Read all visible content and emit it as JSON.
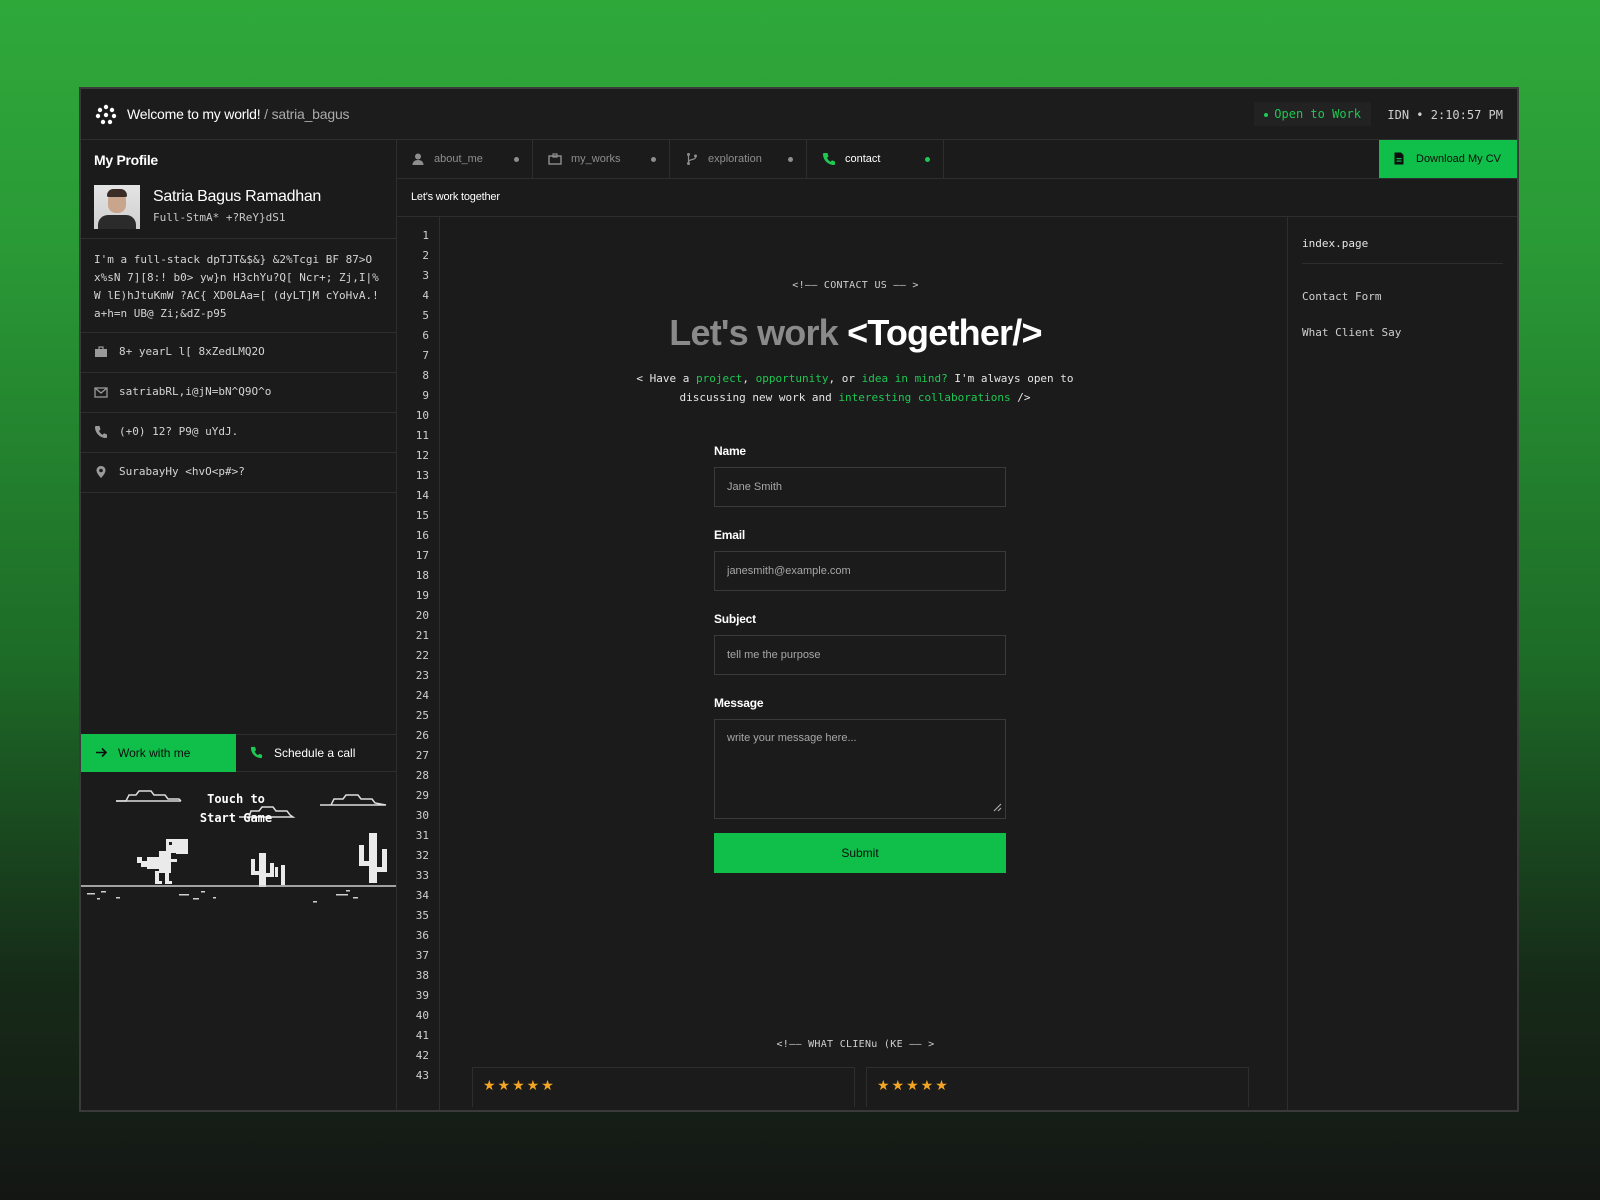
{
  "header": {
    "welcome": "Welcome to my world!",
    "separator": "/",
    "username": "satria_bagus",
    "status": "Open to Work",
    "clock": "IDN • 2:10:57 PM"
  },
  "sidebar": {
    "title": "My Profile",
    "name": "Satria Bagus Ramadhan",
    "role": "Full-StmA* +?ReY}dS1",
    "bio": "I'm a full-stack dpTJT&$&} &2%Tcgi BF 87>Ox%sN 7][8:! b0> yw}n H3chYu?Q[ Ncr+; Zj,I|%W lE)hJtuKmW ?AC{ XD0LAa=[ (dyLT]M cYoHvA.! a+h=n UB@ Zi;&dZ-p95",
    "info": [
      {
        "icon": "briefcase-icon",
        "text": "8+ yearL l[ 8xZedLMQ2O"
      },
      {
        "icon": "mail-icon",
        "text": "satriabRL,i@jN=bN^Q9O^o"
      },
      {
        "icon": "phone-icon",
        "text": "(+0) 12? P9@ uYdJ."
      },
      {
        "icon": "location-pin-icon",
        "text": "SurabayHy <hvO<p#>?"
      }
    ],
    "work_button": "Work with me",
    "call_button": "Schedule a call",
    "game_text_1": "Touch to",
    "game_text_2": "Start Game"
  },
  "tabs": [
    {
      "label": "about_me",
      "icon": "user-icon",
      "active": false
    },
    {
      "label": "my_works",
      "icon": "briefcase-icon",
      "active": false
    },
    {
      "label": "exploration",
      "icon": "git-branch-icon",
      "active": false
    },
    {
      "label": "contact",
      "icon": "phone-icon",
      "active": true
    }
  ],
  "cv_button": "Download My CV",
  "subheader": "Let's work together",
  "line_numbers": [
    "1",
    "2",
    "3",
    "4",
    "5",
    "6",
    "7",
    "8",
    "9",
    "10",
    "11",
    "12",
    "13",
    "14",
    "15",
    "16",
    "17",
    "18",
    "19",
    "20",
    "21",
    "22",
    "23",
    "24",
    "25",
    "26",
    "27",
    "28",
    "29",
    "30",
    "31",
    "32",
    "33",
    "34",
    "35",
    "36",
    "37",
    "38",
    "39",
    "40",
    "41",
    "42",
    "43"
  ],
  "contact": {
    "comment": "<!—— CONTACT US —— >",
    "title_a": "Let's work",
    "title_b": "<Together/>",
    "intro_1": "< Have a",
    "intro_project": "project",
    "intro_comma": ",",
    "intro_opportunity": "opportunity",
    "intro_or": ", or",
    "intro_idea": "idea in mind?",
    "intro_2": "I'm always open to discussing new work and",
    "intro_collab": "interesting collaborations",
    "intro_end": "/>",
    "form": {
      "name_label": "Name",
      "name_placeholder": "Jane Smith",
      "email_label": "Email",
      "email_placeholder": "janesmith@example.com",
      "subject_label": "Subject",
      "subject_placeholder": "tell me the purpose",
      "message_label": "Message",
      "message_placeholder": "write your message here...",
      "submit": "Submit"
    },
    "testimonials_comment": "<!—— WHAT CLIENu (KE —— >",
    "stars": "★★★★★"
  },
  "right_panel": {
    "title": "index.page",
    "items": [
      "Contact Form",
      "What Client Say"
    ]
  },
  "colors": {
    "accent": "#0fbf4a",
    "accent_text": "#1fc753",
    "star": "#f5a524",
    "panel": "#1b1b1b",
    "border": "#2e2e2e"
  }
}
